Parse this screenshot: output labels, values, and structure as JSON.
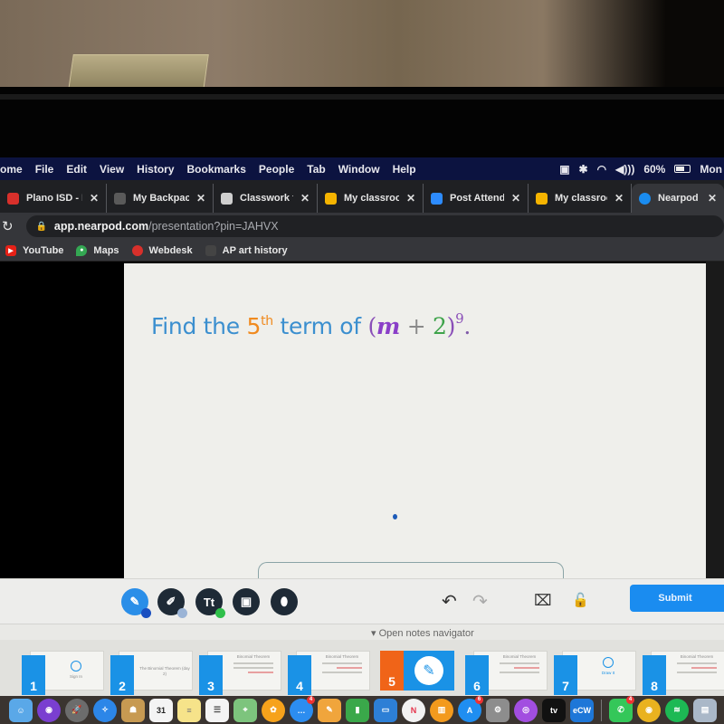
{
  "menubar": {
    "app_name": "ome",
    "items": [
      "File",
      "Edit",
      "View",
      "History",
      "Bookmarks",
      "People",
      "Tab",
      "Window",
      "Help"
    ],
    "status": {
      "battery_percent": "60%",
      "clock": "Mon"
    }
  },
  "tabs": [
    {
      "label": "Plano ISD - M",
      "favicon_color": "#d8302b",
      "close": "✕"
    },
    {
      "label": "My Backpack",
      "favicon_color": "#5a5a5a",
      "close": "✕"
    },
    {
      "label": "Classwork fo",
      "favicon_color": "#cfcfcf",
      "close": "✕"
    },
    {
      "label": "My classroon",
      "favicon_color": "#f5b400",
      "close": "✕"
    },
    {
      "label": "Post Attende",
      "favicon_color": "#2d8cff",
      "close": "✕"
    },
    {
      "label": "My classroon",
      "favicon_color": "#f5b400",
      "close": "✕"
    },
    {
      "label": "Nearpod - Pr",
      "favicon_color": "#1a8cf0",
      "close": "✕",
      "active": true
    }
  ],
  "address": {
    "host": "app.nearpod.com",
    "path": "/presentation?pin=JAHVX"
  },
  "bookmarks": [
    {
      "label": "YouTube",
      "color": "#e62117"
    },
    {
      "label": "Maps",
      "color": "#34a853"
    },
    {
      "label": "Webdesk",
      "color": "#d8302b"
    },
    {
      "label": "AP art history",
      "color": "#444444"
    }
  ],
  "slide": {
    "question": {
      "prefix": "Find the ",
      "ordinal": "5",
      "ordinal_suffix": "th",
      "middle": " term of ",
      "open_paren": "(",
      "variable": "m",
      "plus": " + ",
      "constant": "2",
      "close_paren": ")",
      "exponent": "9",
      "end": "."
    },
    "colors": {
      "text": "#3b8fcf",
      "ordinal": "#f08a1e",
      "variable": "#8a3fc8",
      "constant": "#3ea34a"
    }
  },
  "toolbar": {
    "tools": [
      {
        "name": "pencil",
        "glyph": "✎",
        "badge_color": "#1a4fc0",
        "selected": true
      },
      {
        "name": "highlighter",
        "glyph": "✐",
        "badge_color": "#9bb4d6"
      },
      {
        "name": "text",
        "glyph": "Tt",
        "badge_color": "#2fbf4a"
      },
      {
        "name": "image",
        "glyph": "▣"
      },
      {
        "name": "eraser",
        "glyph": "⬮"
      }
    ],
    "undo": "↶",
    "redo": "↷",
    "clear": "⌧",
    "lock": "🔓",
    "submit_label": "Submit"
  },
  "notes_navigator": {
    "label": "▾ Open notes navigator"
  },
  "slide_navigator": {
    "thumbnails": [
      {
        "number": "1",
        "caption": "Sign In",
        "type": "signin"
      },
      {
        "number": "2",
        "caption": "The Binomial Theorem (day 2)",
        "type": "title"
      },
      {
        "number": "3",
        "caption": "Binomial Theorem",
        "type": "content"
      },
      {
        "number": "4",
        "caption": "Binomial Theorem",
        "type": "content"
      },
      {
        "number": "5",
        "caption": "",
        "type": "current"
      },
      {
        "number": "6",
        "caption": "Binomial Theorem",
        "type": "content"
      },
      {
        "number": "7",
        "caption": "Draw It",
        "type": "draw"
      },
      {
        "number": "8",
        "caption": "Binomial Theorem",
        "type": "content"
      }
    ]
  },
  "dock": {
    "apps": [
      {
        "name": "finder",
        "color": "#5aa8e8",
        "glyph": "☺"
      },
      {
        "name": "siri",
        "color": "#7a3fd0",
        "glyph": "◉",
        "round": true
      },
      {
        "name": "launchpad",
        "color": "#6c6c6c",
        "glyph": "🚀",
        "round": true
      },
      {
        "name": "safari",
        "color": "#2c86e8",
        "glyph": "✧",
        "round": true
      },
      {
        "name": "contacts",
        "color": "#c79a52",
        "glyph": "☗"
      },
      {
        "name": "calendar",
        "color": "#f4f4f4",
        "glyph": "31",
        "text_color": "#222"
      },
      {
        "name": "notes",
        "color": "#f6e38a",
        "glyph": "≡",
        "text_color": "#777"
      },
      {
        "name": "reminders",
        "color": "#f4f4f4",
        "glyph": "☰",
        "text_color": "#555"
      },
      {
        "name": "maps",
        "color": "#7dc47d",
        "glyph": "⌖"
      },
      {
        "name": "photos",
        "color": "#f6a21b",
        "glyph": "✿",
        "round": true
      },
      {
        "name": "messages",
        "color": "#2c8df0",
        "glyph": "…",
        "round": true,
        "badge": "4"
      },
      {
        "name": "pages",
        "color": "#f0a53c",
        "glyph": "✎"
      },
      {
        "name": "numbers",
        "color": "#3aa84a",
        "glyph": "▮"
      },
      {
        "name": "keynote",
        "color": "#2d7fd6",
        "glyph": "▭"
      },
      {
        "name": "news",
        "color": "#f2f2f2",
        "glyph": "N",
        "text_color": "#e5334b",
        "round": true
      },
      {
        "name": "books",
        "color": "#f39a1d",
        "glyph": "▥",
        "round": true
      },
      {
        "name": "app-store",
        "color": "#1f8ef1",
        "glyph": "A",
        "round": true,
        "badge": "6"
      },
      {
        "name": "system-preferences",
        "color": "#8d8d8d",
        "glyph": "⚙"
      },
      {
        "name": "podcasts",
        "color": "#a24ee0",
        "glyph": "◎",
        "round": true
      },
      {
        "name": "apple-tv",
        "color": "#111111",
        "glyph": "tv"
      },
      {
        "name": "ecw",
        "color": "#1e77d8",
        "glyph": "eCW"
      },
      {
        "name": "facetime",
        "color": "#34c759",
        "glyph": "✆",
        "badge": "4"
      },
      {
        "name": "chrome",
        "color": "#e9b21f",
        "glyph": "◉",
        "round": true
      },
      {
        "name": "spotify",
        "color": "#1db954",
        "glyph": "≋",
        "round": true
      },
      {
        "name": "preview",
        "color": "#aab8c8",
        "glyph": "▤"
      }
    ]
  }
}
